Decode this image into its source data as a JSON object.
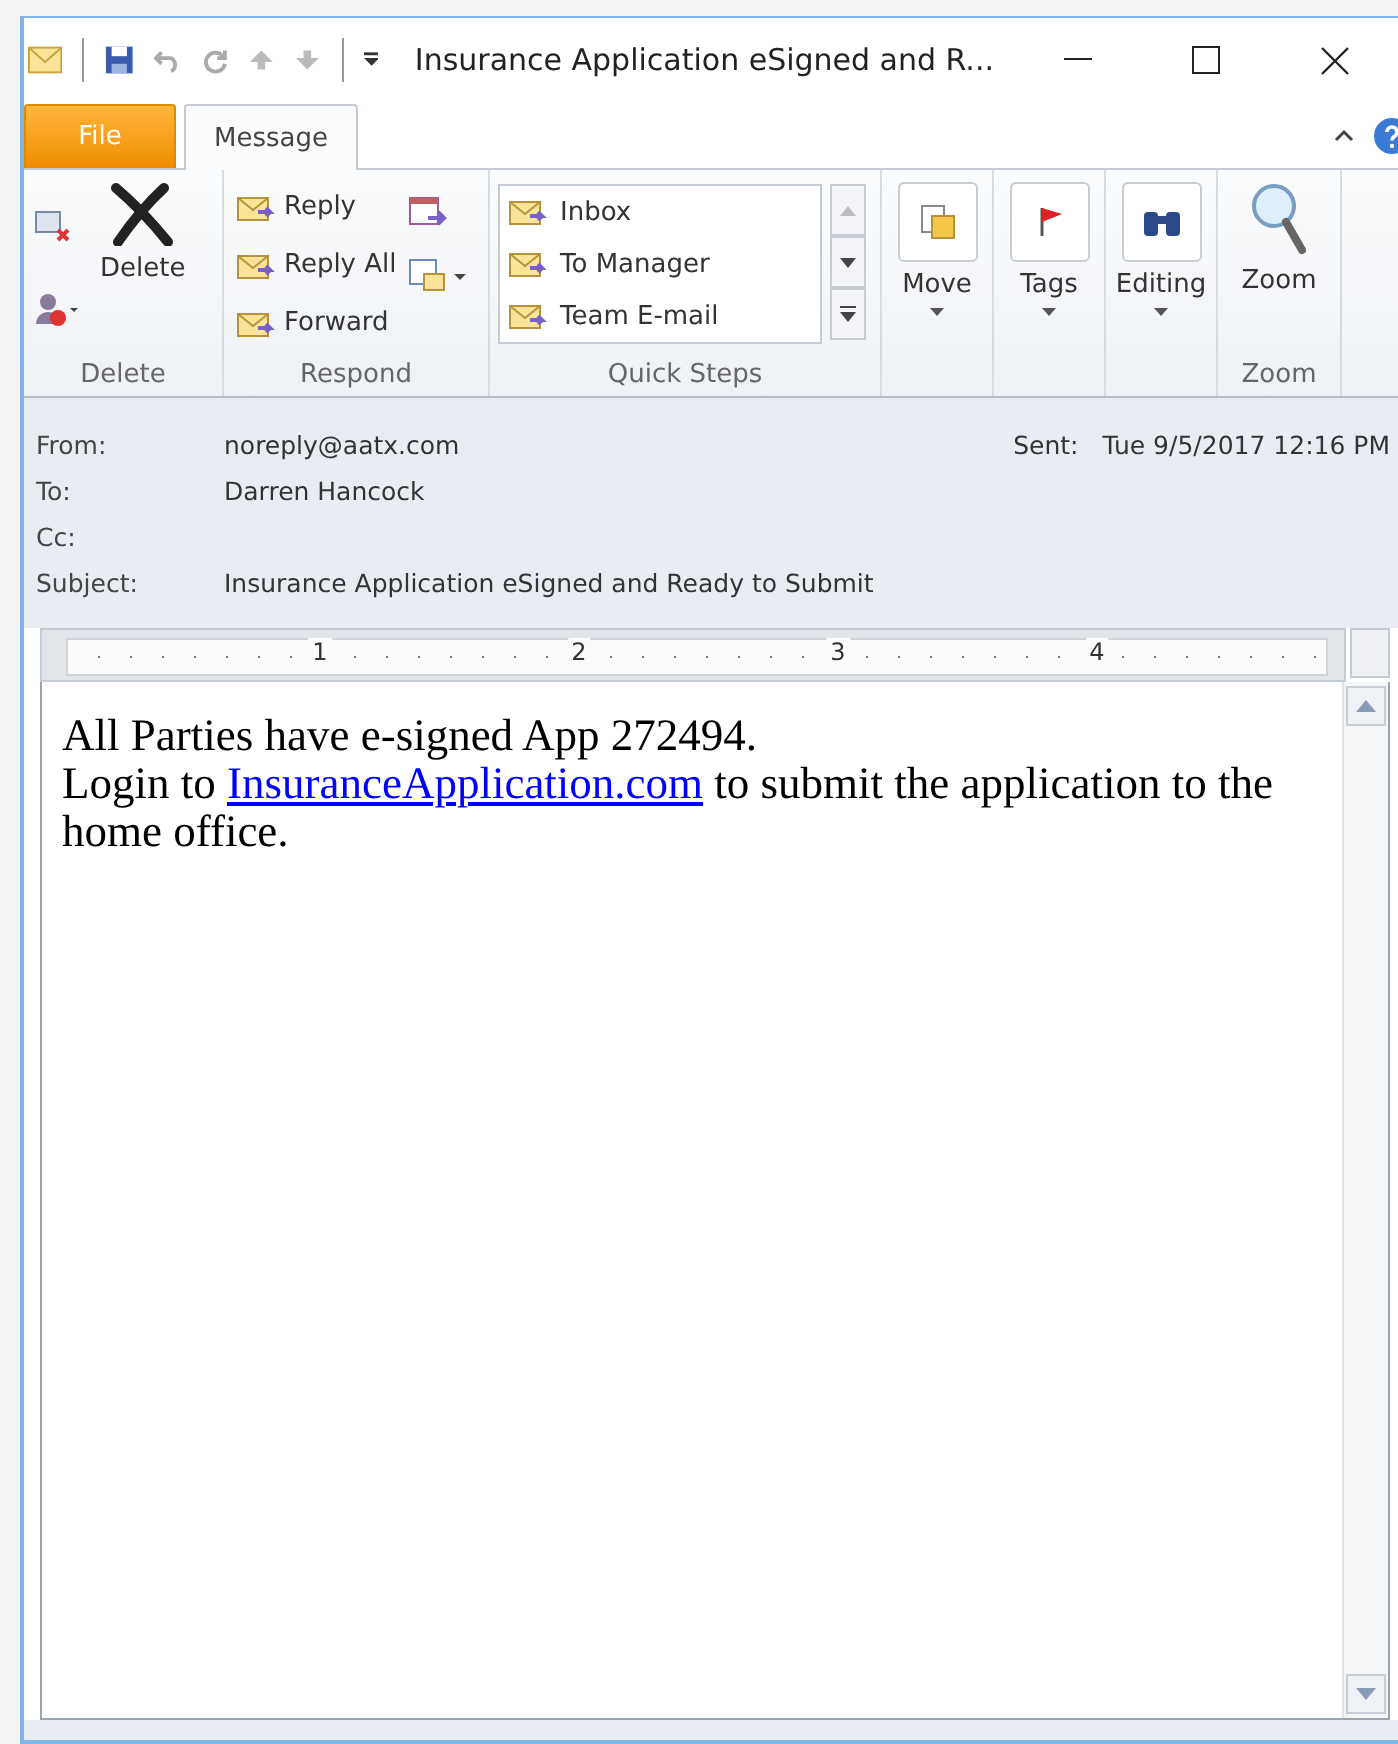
{
  "window": {
    "title": "Insurance Application eSigned and R..."
  },
  "tabs": [
    {
      "label": "File",
      "kind": "file",
      "selected": false
    },
    {
      "label": "Message",
      "kind": "tab",
      "selected": true
    }
  ],
  "ribbon": {
    "delete": {
      "label": "Delete",
      "button": "Delete"
    },
    "respond": {
      "label": "Respond",
      "buttons": [
        "Reply",
        "Reply All",
        "Forward"
      ]
    },
    "quick_steps": {
      "label": "Quick Steps",
      "items": [
        "Inbox",
        "To Manager",
        "Team E-mail"
      ]
    },
    "move": {
      "button": "Move"
    },
    "tags": {
      "button": "Tags"
    },
    "editing": {
      "button": "Editing"
    },
    "zoom": {
      "label": "Zoom",
      "button": "Zoom"
    }
  },
  "header": {
    "fields": [
      {
        "label": "From:",
        "value": "noreply@aatx.com"
      },
      {
        "label": "To:",
        "value": "Darren Hancock"
      },
      {
        "label": "Cc:"
      },
      {
        "label": "Subject:",
        "value": "Insurance Application eSigned and Ready to Submit"
      }
    ],
    "sent": {
      "label": "Sent:",
      "value": "Tue 9/5/2017 12:16 PM"
    }
  },
  "ruler": {
    "numbers": [
      "1",
      "2",
      "3",
      "4"
    ]
  },
  "body": {
    "line_1": "All Parties have e-signed App 272494.",
    "line_2": {
      "before": "Login to ",
      "link": "InsuranceApplication.com",
      "after": " to submit the application to the home office."
    }
  }
}
